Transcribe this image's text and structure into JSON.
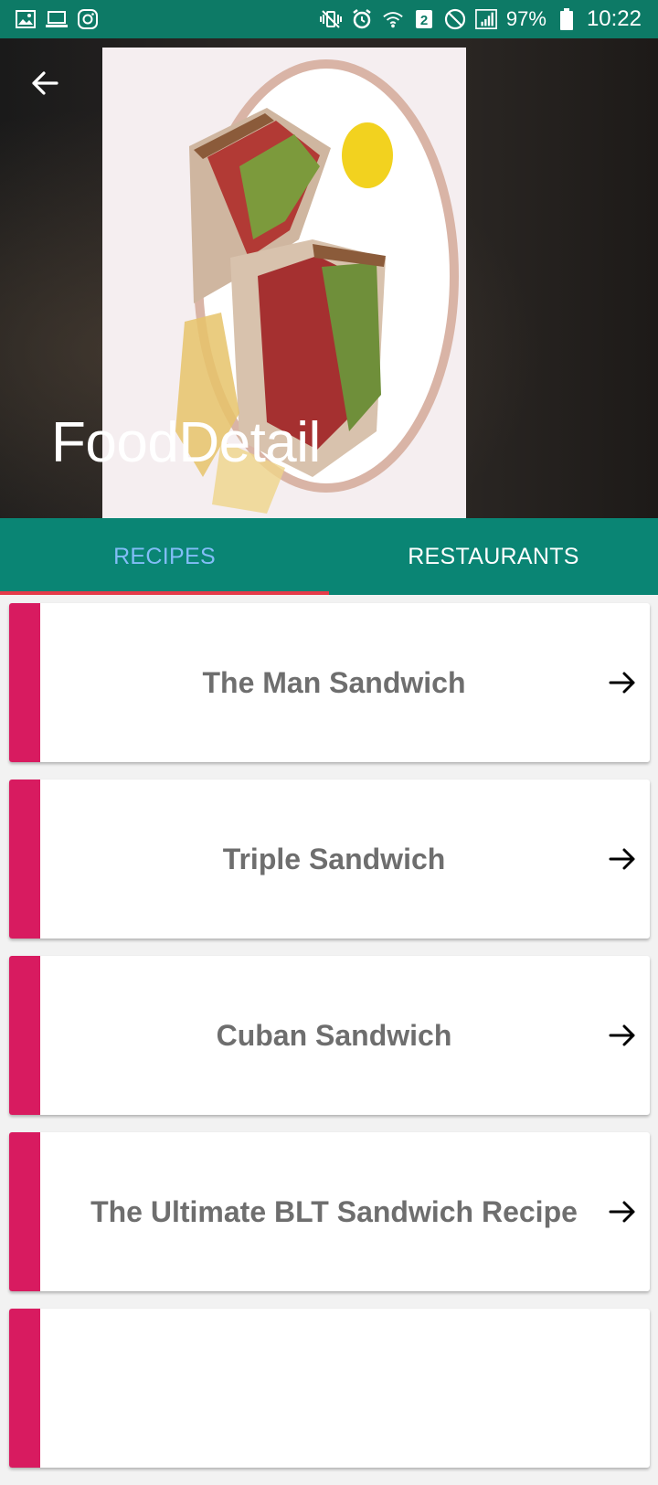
{
  "status_bar": {
    "battery": "97%",
    "time": "10:22",
    "sim_badge": "2",
    "icons": [
      "gallery-icon",
      "cast-icon",
      "instagram-icon",
      "vibrate-off-icon",
      "alarm-icon",
      "wifi-icon",
      "sim-2-icon",
      "block-icon",
      "signal-icon",
      "battery-icon"
    ]
  },
  "header": {
    "title": "FoodDetail",
    "back_icon": "arrow-back-icon"
  },
  "tabs": [
    {
      "label": "RECIPES",
      "active": true
    },
    {
      "label": "RESTAURANTS",
      "active": false
    }
  ],
  "colors": {
    "status_bar": "#0d7a66",
    "tab_bar": "#0a8574",
    "tab_active_text": "#82bdf7",
    "tab_indicator": "#e53b49",
    "card_stripe": "#d81b60",
    "card_text": "#6e6e6e"
  },
  "recipes": [
    {
      "title": "The Man Sandwich",
      "icon": "arrow-forward-icon"
    },
    {
      "title": "Triple Sandwich",
      "icon": "arrow-forward-icon"
    },
    {
      "title": "Cuban Sandwich",
      "icon": "arrow-forward-icon"
    },
    {
      "title": "The Ultimate BLT Sandwich Recipe",
      "icon": "arrow-forward-icon"
    },
    {
      "title": "",
      "icon": ""
    }
  ]
}
